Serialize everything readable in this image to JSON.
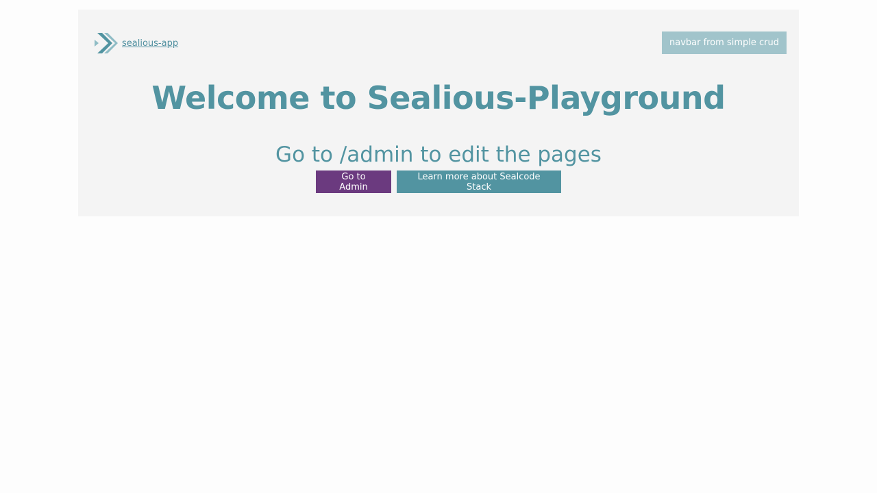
{
  "header": {
    "app_name": "sealious-app",
    "logo_icon": "double-chevron-right-icon",
    "nav_button_label": "navbar from simple crud"
  },
  "main": {
    "title": "Welcome to Sealious-Playground",
    "subtitle": "Go to /admin to edit the pages",
    "buttons": {
      "admin_label": "Go to Admin",
      "learn_label": "Learn more about Sealcode Stack"
    }
  },
  "colors": {
    "page_background": "#fdfdfd",
    "panel_background": "#f4f4f4",
    "accent_teal": "#5294a1",
    "nav_button_bg": "#a1c4cb",
    "admin_button_bg": "#6b3a7f"
  }
}
